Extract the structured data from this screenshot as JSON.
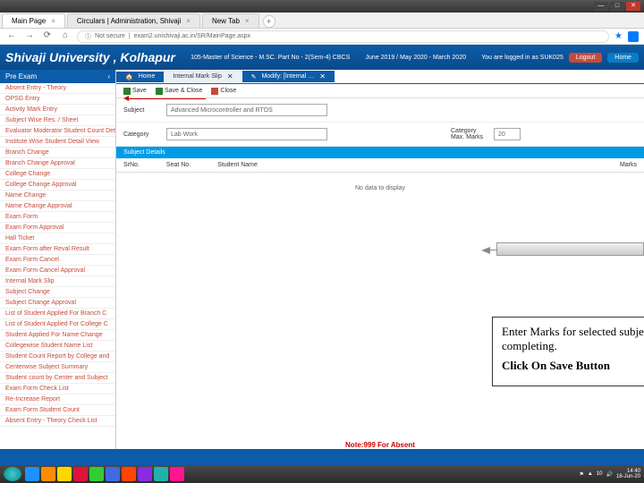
{
  "window": {
    "min": "—",
    "max": "□",
    "close": "✕"
  },
  "browser": {
    "tabs": [
      {
        "label": "Main Page"
      },
      {
        "label": "Circulars | Administration, Shivaji"
      },
      {
        "label": "New Tab"
      }
    ],
    "newtab": "+",
    "back": "←",
    "fwd": "→",
    "reload": "⟳",
    "home": "⌂",
    "lock": "ⓘ",
    "addr_label": "Not secure",
    "addr": "exam2.unishivaji.ac.in/SR/MainPage.aspx",
    "star": "★"
  },
  "header": {
    "title": "Shivaji University , Kolhapur",
    "program": "105-Master of Science - M.SC. Part No - 2(Sem-4) CBCS",
    "dates": "June 2019 / May 2020 - March  2020",
    "logged": "You are logged  in as SUK025",
    "logout": "Logout",
    "home": "Home"
  },
  "sidebar": {
    "head": "Pre Exam",
    "collapse": "‹",
    "items": [
      "Absent Entry - Theory",
      "OPSG Entry",
      "Activity Mark Entry",
      "Subject Wise Res. / Sheet",
      "Evaluator Moderator Student Count Details List",
      "Institute Wise Student Detail View",
      "Branch Change",
      "Branch Change Approval",
      "College Change",
      "College Change Approval",
      "Name Change",
      "Name Change Approval",
      "Exam Form",
      "Exam Form Approval",
      "Hall Ticket",
      "Exam Form after Reval Result",
      "Exam Form Cancel",
      "Exam Form Cancel Approval",
      "Internal Mark Slip",
      "Subject Change",
      "Subject Change Approval",
      "List of Student Applied For Branch C",
      "List of Student Applied For College C",
      "Student Applied For Name Change",
      "Collegewise Student Name List",
      "Student Count Report by College and",
      "Centerwise Subject Summary",
      "Student count by Center and Subject",
      "Exam Form Check List",
      "Re-Increase Report",
      "Exam Form Student Count",
      "Absent Entry - Theory Check List"
    ]
  },
  "tabs2": {
    "home": "Home",
    "t1": "Internal Mark Slip",
    "x": "✕",
    "t2": "Modify: [Internal …"
  },
  "toolbar": {
    "save": "Save",
    "saveclose": "Save & Close",
    "close": "Close"
  },
  "form": {
    "subject_lbl": "Subject",
    "subject_val": "Advanced Microcontroller and RTOS",
    "category_lbl": "Category",
    "category_val": "Lab Work",
    "catmax_lbl": "Category Max. Marks",
    "catmax_val": "20"
  },
  "section": "Subject Details",
  "thead": {
    "c1": "SrNo.",
    "c2": "Seat No.",
    "c3": "Student Name",
    "c4": "Marks"
  },
  "nodata": "No data to display",
  "note": "Note:999 For Absent",
  "callout": {
    "line1": "Enter Marks for selected subject after completing.",
    "line2": "Click On Save Button"
  },
  "tray": {
    "count": "10",
    "time": "14:40",
    "date": "18-Jun-20"
  },
  "task_icons": [
    "#1e90ff",
    "#ff8c00",
    "#ffd700",
    "#dc143c",
    "#32cd32",
    "#4169e1",
    "#ff4500",
    "#8a2be2",
    "#20b2aa",
    "#ff1493"
  ]
}
